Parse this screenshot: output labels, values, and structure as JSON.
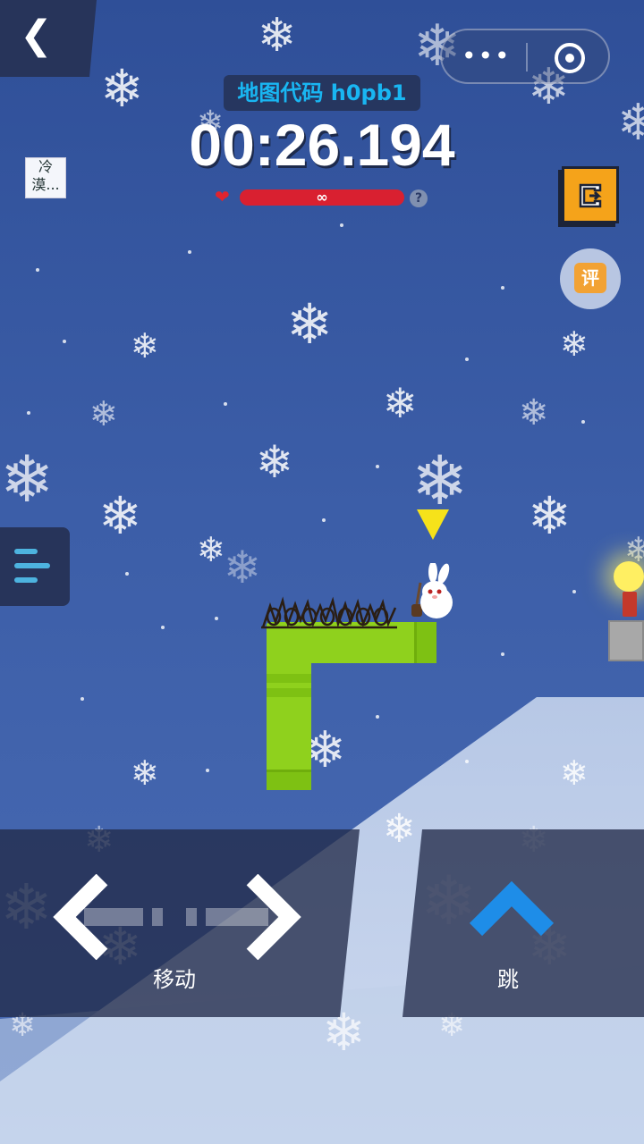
{
  "header": {
    "back_icon": "chevron-left-icon",
    "menu_more_icon": "more-dots-icon",
    "menu_close_icon": "target-circle-icon",
    "map_code": "地图代码 h0pb1",
    "timer": "00:26.194",
    "hp_value": "∞",
    "help_icon": "question-icon",
    "help_text": "?"
  },
  "side": {
    "avatar_text": "冷漠...",
    "exit_icon": "exit-door-icon",
    "rate_label": "评"
  },
  "controls": {
    "move_label": "移动",
    "jump_label": "跳"
  },
  "colors": {
    "map_code_text": "#19b6f2",
    "hp_bar": "#d92030",
    "pipe": "#8fd11d",
    "exit_button": "#f5a31a",
    "rate_badge": "#f2a234",
    "jump_arrow": "#1e8de8",
    "menu_lines": "#4db3df"
  }
}
